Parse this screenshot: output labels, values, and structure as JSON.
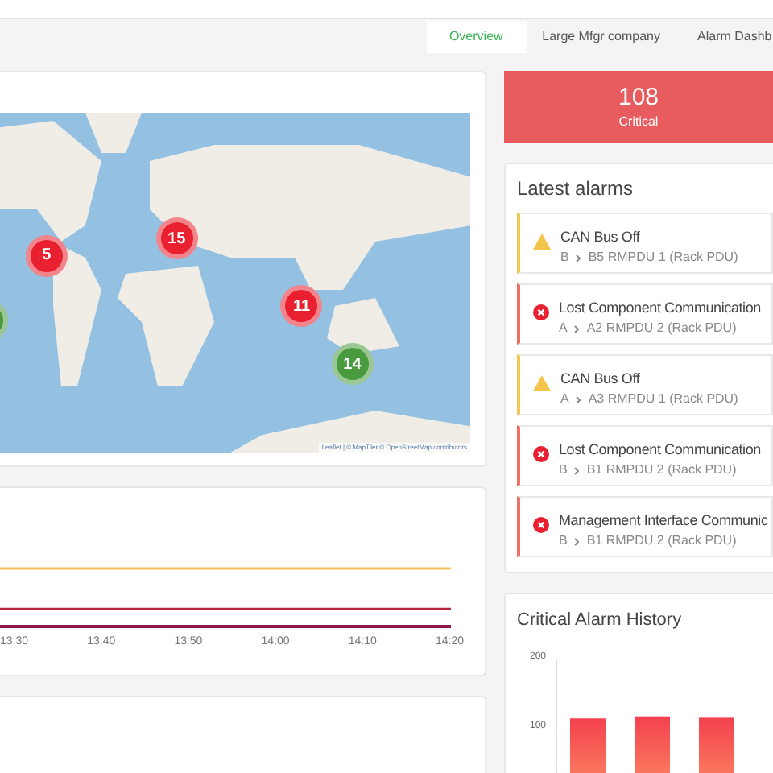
{
  "tabs": [
    {
      "label": "Overview",
      "selected": true
    },
    {
      "label": "Large Mfgr company",
      "selected": false
    },
    {
      "label": "Alarm Dashb",
      "selected": false
    }
  ],
  "map": {
    "markers": [
      {
        "label": "5",
        "color": "#e8202f"
      },
      {
        "label": "15",
        "color": "#e8202f"
      },
      {
        "label": "11",
        "color": "#e8202f"
      },
      {
        "label": "14",
        "color": "#4a9a3f"
      },
      {
        "color": "#4a9a3f"
      }
    ],
    "attribution": "Leaflet | © MapTiler © OpenStreetMap contributors"
  },
  "line_chart": {
    "x_labels": [
      "13:30",
      "13:40",
      "13:50",
      "14:00",
      "14:10",
      "14:20"
    ]
  },
  "critical": {
    "count": "108",
    "label": "Critical"
  },
  "latest_alarms": {
    "title": "Latest alarms",
    "items": [
      {
        "kind": "warning",
        "title": "CAN Bus Off",
        "path": [
          "B",
          "B5 RMPDU 1 (Rack PDU)"
        ]
      },
      {
        "kind": "error",
        "title": "Lost Component Communication",
        "path": [
          "A",
          "A2 RMPDU 2 (Rack PDU)"
        ]
      },
      {
        "kind": "warning",
        "title": "CAN Bus Off",
        "path": [
          "A",
          "A3 RMPDU 1 (Rack PDU)"
        ]
      },
      {
        "kind": "error",
        "title": "Lost Component Communication",
        "path": [
          "B",
          "B1 RMPDU 2 (Rack PDU)"
        ]
      },
      {
        "kind": "error",
        "title": "Management Interface Communic",
        "path": [
          "B",
          "B1 RMPDU 2 (Rack PDU)"
        ]
      }
    ]
  },
  "history": {
    "title": "Critical Alarm History",
    "y_labels": [
      "200",
      "100"
    ]
  }
}
